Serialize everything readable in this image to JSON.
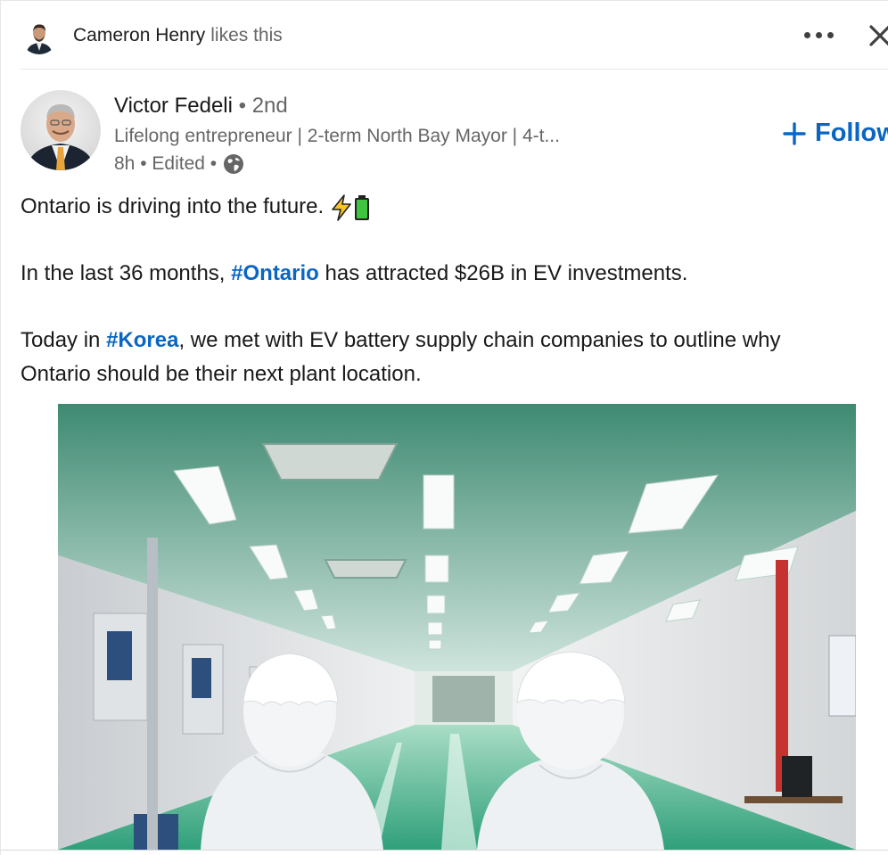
{
  "social": {
    "actor_name": "Cameron Henry",
    "action": "likes this",
    "avatar_icon": "person-avatar-icon",
    "more_icon": "more-options-icon",
    "close_icon": "close-icon"
  },
  "author": {
    "name": "Victor Fedeli",
    "degree": "• 2nd",
    "headline": "Lifelong entrepreneur | 2-term North Bay Mayor | 4-t...",
    "time": "8h",
    "separator1": "•",
    "edited": "Edited",
    "separator2": "•",
    "visibility_icon": "globe-icon",
    "follow_label": "Follow"
  },
  "post": {
    "line1": "Ontario is driving into the future.",
    "line1_emojis": [
      "lightning-icon",
      "battery-icon"
    ],
    "line2_prefix": "In the last 36 months,",
    "line2_hashtag": "#Ontario",
    "line2_suffix": "has attracted $26B in EV investments.",
    "line3_prefix": "Today in",
    "line3_hashtag": "#Korea",
    "line3_suffix": ", we met with EV battery supply chain companies to outline why",
    "line4": "Ontario should be their next plant location."
  },
  "colors": {
    "link": "#0a66c2",
    "text": "#191919",
    "muted": "#666666"
  }
}
